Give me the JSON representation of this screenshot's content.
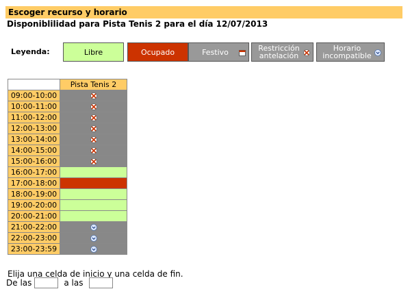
{
  "header": {
    "title": "Escoger recurso y horario"
  },
  "subtitle": "Disponiblilidad para Pista Tenis 2 para el día 12/07/2013",
  "legend": {
    "label": "Leyenda:",
    "items": [
      {
        "key": "libre",
        "label": "Libre",
        "color": "#ccff99"
      },
      {
        "key": "ocupado",
        "label": "Ocupado",
        "color": "#cc3300"
      },
      {
        "key": "festivo",
        "label": "Festivo",
        "color": "#999999",
        "icon": "calendar-icon"
      },
      {
        "key": "restriccion",
        "label": "Restricción antelación",
        "color": "#999999",
        "icon": "restriction-icon"
      },
      {
        "key": "horario",
        "label": "Horario incompatible",
        "color": "#999999",
        "icon": "chevron-down-icon"
      }
    ]
  },
  "table": {
    "court": "Pista Tenis 2",
    "rows": [
      {
        "time": "09:00-10:00",
        "state": "restr"
      },
      {
        "time": "10:00-11:00",
        "state": "restr"
      },
      {
        "time": "11:00-12:00",
        "state": "restr"
      },
      {
        "time": "12:00-13:00",
        "state": "restr"
      },
      {
        "time": "13:00-14:00",
        "state": "restr"
      },
      {
        "time": "14:00-15:00",
        "state": "restr"
      },
      {
        "time": "15:00-16:00",
        "state": "restr"
      },
      {
        "time": "16:00-17:00",
        "state": "free"
      },
      {
        "time": "17:00-18:00",
        "state": "busy"
      },
      {
        "time": "18:00-19:00",
        "state": "free"
      },
      {
        "time": "19:00-20:00",
        "state": "free"
      },
      {
        "time": "20:00-21:00",
        "state": "free"
      },
      {
        "time": "21:00-22:00",
        "state": "incomp"
      },
      {
        "time": "22:00-23:00",
        "state": "incomp"
      },
      {
        "time": "23:00-23:59",
        "state": "incomp"
      }
    ]
  },
  "instructions": "Elija una celda de inicio y una celda de fin.",
  "range": {
    "from_label": "De las",
    "to_label": "a las",
    "from_value": "",
    "to_value": ""
  }
}
